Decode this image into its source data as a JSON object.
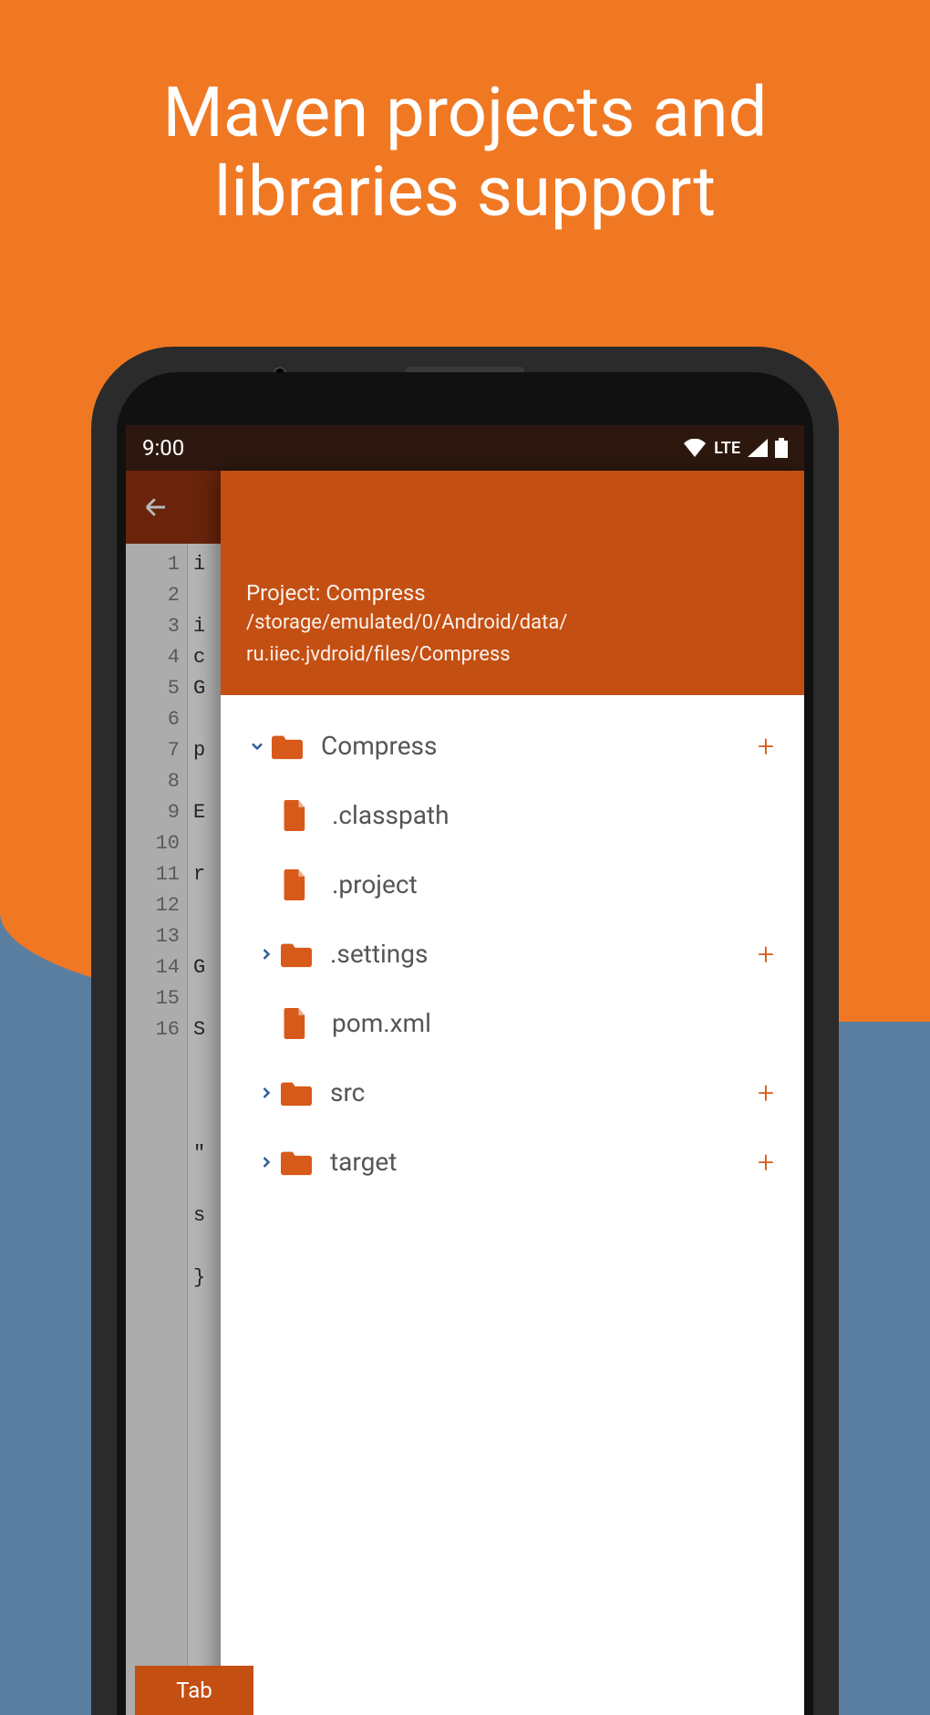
{
  "marketing": {
    "heading_line1": "Maven projects and",
    "heading_line2": "libraries support"
  },
  "statusbar": {
    "time": "9:00",
    "network": "LTE"
  },
  "editor": {
    "lines": [
      "1",
      "2",
      "3",
      "4",
      "5",
      "6",
      "7",
      "8",
      "9",
      "10",
      "11",
      "12",
      "13",
      "14",
      "15",
      "16"
    ],
    "code_fragments": [
      "i",
      "",
      "i",
      "c",
      "G",
      "",
      "p",
      "",
      "E",
      "",
      "r",
      "",
      "",
      "G",
      "",
      "S",
      "",
      "",
      "",
      "\"",
      "",
      "s",
      "",
      "}"
    ]
  },
  "drawer": {
    "title": "Project: Compress",
    "path_line1": "/storage/emulated/0/Android/data/",
    "path_line2": "ru.iiec.jvdroid/files/Compress"
  },
  "tree": {
    "root": "Compress",
    "items": [
      {
        "label": ".classpath",
        "type": "file"
      },
      {
        "label": ".project",
        "type": "file"
      },
      {
        "label": ".settings",
        "type": "folder"
      },
      {
        "label": "pom.xml",
        "type": "file"
      },
      {
        "label": "src",
        "type": "folder"
      },
      {
        "label": "target",
        "type": "folder"
      }
    ]
  },
  "tab": {
    "label": "Tab"
  },
  "colors": {
    "accent": "#d85a1a"
  }
}
